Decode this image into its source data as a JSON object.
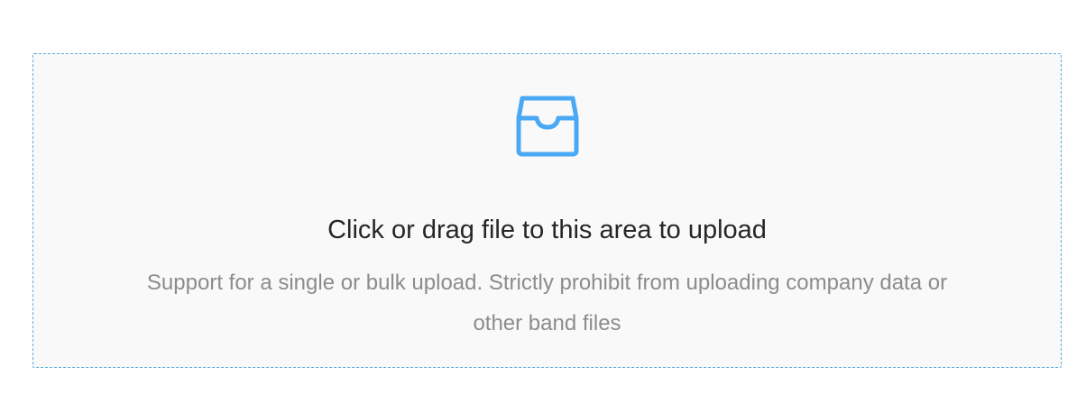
{
  "upload": {
    "icon": "inbox-icon",
    "accent_color": "#4aa9f5",
    "title": "Click or drag file to this area to upload",
    "hint_line1": "Support for a single or bulk upload. Strictly prohibit from uploading company data or",
    "hint_line2": "other band files"
  }
}
